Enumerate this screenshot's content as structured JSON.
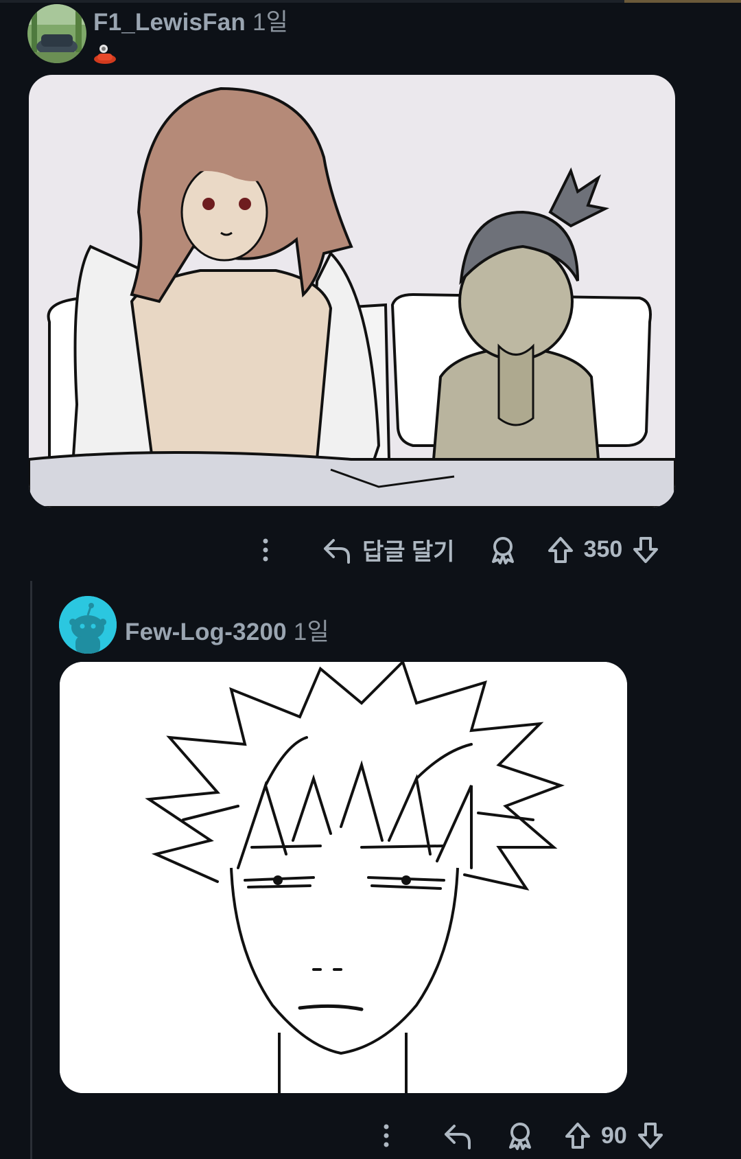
{
  "comments": [
    {
      "username": "F1_LewisFan",
      "age": "1일",
      "actions": {
        "reply_label": "답글 달기",
        "score": "350"
      },
      "image_alt": "Drawing of two characters in bed"
    },
    {
      "username": "Few-Log-3200",
      "age": "1일",
      "actions": {
        "score": "90"
      },
      "image_alt": "Sketch of a spiky-haired character face"
    }
  ],
  "colors": {
    "background": "#0d1117",
    "text": "#aeb8c2",
    "avatar2": "#2bc7e0"
  }
}
